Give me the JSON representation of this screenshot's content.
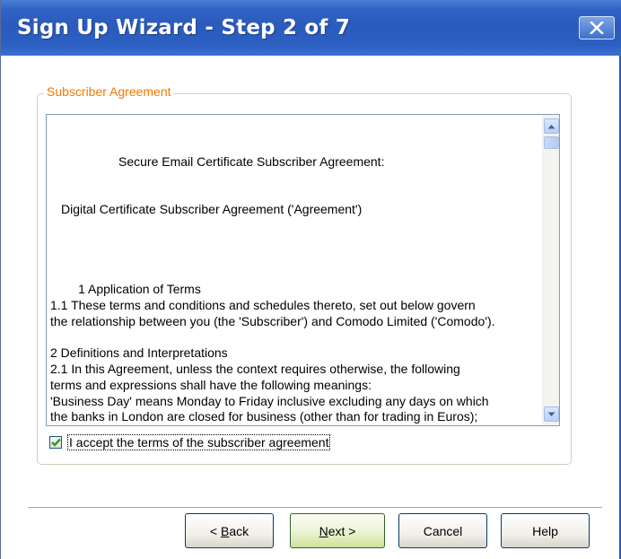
{
  "window": {
    "title": "Sign Up Wizard - Step 2 of 7"
  },
  "group": {
    "legend": "Subscriber Agreement"
  },
  "agreement": {
    "heading_line1": "Secure Email Certificate Subscriber Agreement:",
    "heading_line2": "Digital Certificate Subscriber Agreement ('Agreement')",
    "body": "1 Application of Terms\n1.1 These terms and conditions and schedules thereto, set out below govern\nthe relationship between you (the 'Subscriber') and Comodo Limited ('Comodo').\n\n2 Definitions and Interpretations\n2.1 In this Agreement, unless the context requires otherwise, the following\nterms and expressions shall have the following meanings:\n'Business Day' means Monday to Friday inclusive excluding any days on which\nthe banks in London are closed for business (other than for trading in Euros);\n'Certificate Period' means the time period during which a Digital Certificate\nremains valid and may be used as set out in the Schedule;"
  },
  "accept": {
    "label": "I accept the terms of the subscriber agreement",
    "checked": true
  },
  "buttons": {
    "back_mnemonic": "B",
    "back_rest": "ack",
    "back_prefix": "< ",
    "next_mnemonic": "N",
    "next_rest": "ext >",
    "cancel": "Cancel",
    "help": "Help"
  },
  "colors": {
    "title_bar": "#2a5bbd",
    "legend_text": "#f27900",
    "check_mark": "#21a121"
  },
  "icons": {
    "close": "close-icon",
    "scroll_up": "scroll-up-arrow-icon",
    "scroll_down": "scroll-down-arrow-icon",
    "check": "checkmark-icon"
  }
}
